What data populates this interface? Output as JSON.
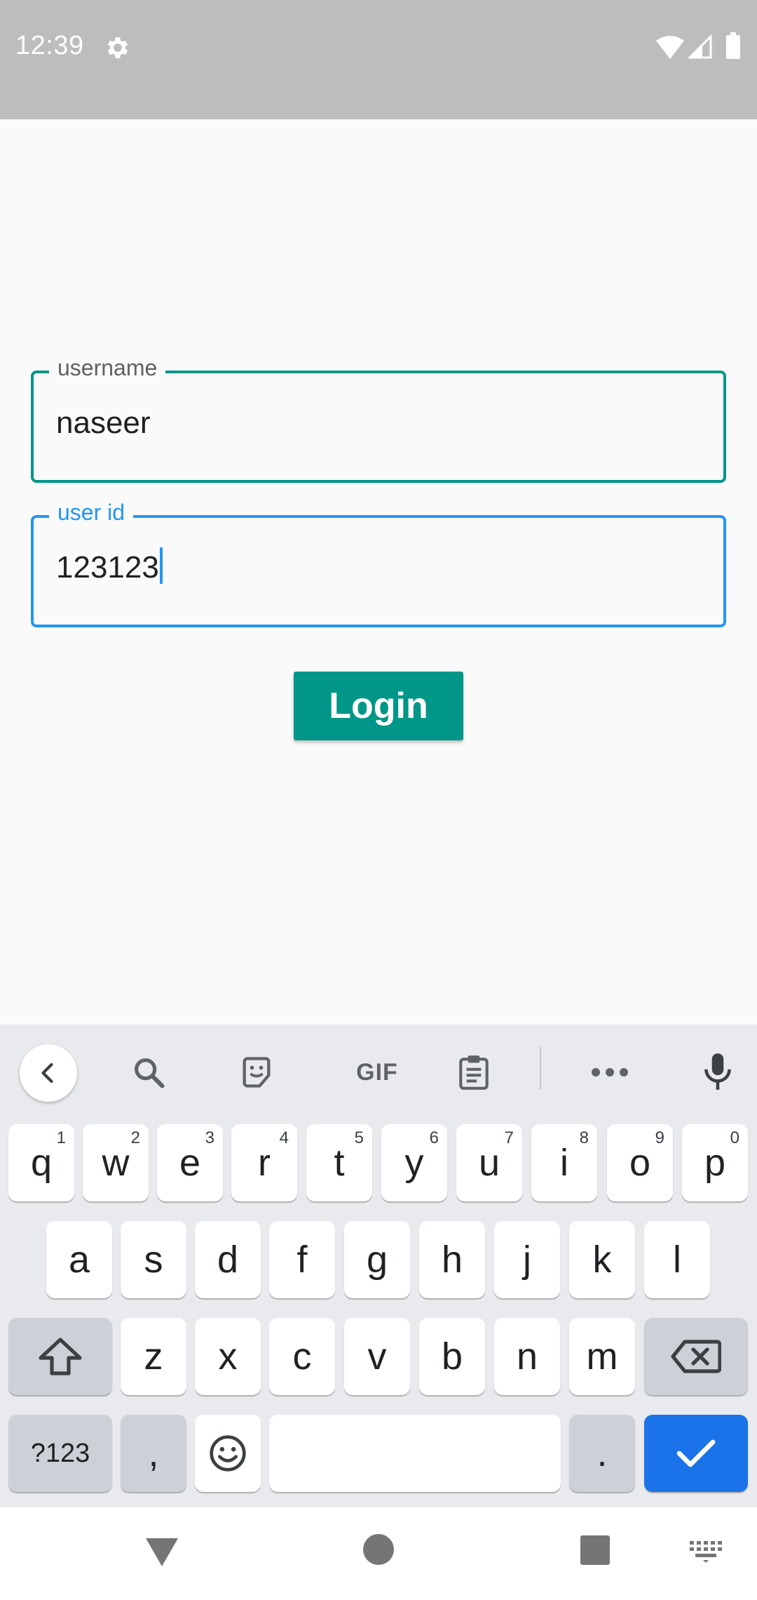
{
  "status_bar": {
    "time": "12:39",
    "icons": [
      "settings-gear-icon",
      "wifi-icon",
      "cell-signal-icon",
      "battery-icon"
    ]
  },
  "form": {
    "username": {
      "label": "username",
      "value": "naseer"
    },
    "user_id": {
      "label": "user id",
      "value": "123123"
    },
    "login_label": "Login"
  },
  "keyboard": {
    "toolbar": {
      "icons": [
        "chevron-left-icon",
        "search-icon",
        "sticker-icon",
        "gif-button",
        "clipboard-icon",
        "more-icon",
        "microphone-icon"
      ],
      "gif_label": "GIF"
    },
    "row1": [
      {
        "key": "q",
        "hint": "1"
      },
      {
        "key": "w",
        "hint": "2"
      },
      {
        "key": "e",
        "hint": "3"
      },
      {
        "key": "r",
        "hint": "4"
      },
      {
        "key": "t",
        "hint": "5"
      },
      {
        "key": "y",
        "hint": "6"
      },
      {
        "key": "u",
        "hint": "7"
      },
      {
        "key": "i",
        "hint": "8"
      },
      {
        "key": "o",
        "hint": "9"
      },
      {
        "key": "p",
        "hint": "0"
      }
    ],
    "row2": [
      "a",
      "s",
      "d",
      "f",
      "g",
      "h",
      "j",
      "k",
      "l"
    ],
    "row3": [
      "z",
      "x",
      "c",
      "v",
      "b",
      "n",
      "m"
    ],
    "row4": {
      "symbols": "?123",
      "comma": ",",
      "period": "."
    }
  },
  "colors": {
    "accent": "#009688",
    "focus": "#2196f3",
    "enter_key": "#1a73e8",
    "status_bar": "#bdbdbd",
    "keyboard_bg": "#e8eaed"
  },
  "nav_bar": {
    "icons": [
      "nav-back-icon",
      "nav-home-icon",
      "nav-recents-icon",
      "keyboard-switch-icon"
    ]
  }
}
